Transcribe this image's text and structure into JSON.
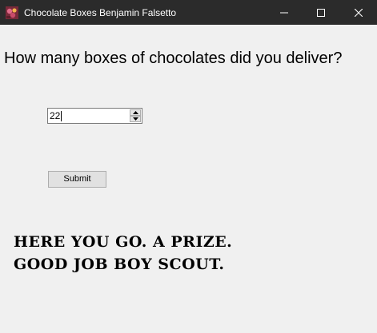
{
  "window": {
    "title": "Chocolate Boxes Benjamin Falsetto",
    "icon": "app-icon",
    "controls": [
      "minimize-icon",
      "maximize-icon",
      "close-icon"
    ]
  },
  "form": {
    "question": "How many boxes of chocolates did you deliver?",
    "quantity_value": "22",
    "spinner_icons": [
      "chevron-up-icon",
      "chevron-down-icon"
    ],
    "submit_label": "Submit"
  },
  "result": {
    "line1": "HERE YOU GO. A PRIZE.",
    "line2": "GOOD JOB BOY SCOUT."
  },
  "colors": {
    "titlebar": "#2b2b2b",
    "background": "#f0f0f0",
    "text": "#000000"
  }
}
